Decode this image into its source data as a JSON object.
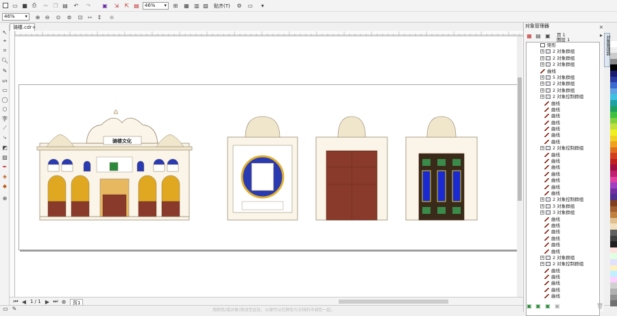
{
  "doc_tab": "骑楼.cdr",
  "toolbar": {
    "zoom": "46%",
    "snap": "贴齐(T)"
  },
  "propbar": {
    "zoom": "46%"
  },
  "building_sign": "骑楼文化",
  "pager": {
    "page": "1 / 1",
    "tab": "页1"
  },
  "status_hint": "用颜色/或对象(拖动至此处。以便可以在颜色与文档的中调色一起。",
  "panel": {
    "title": "对象管理器",
    "page": "页 1",
    "layer": "图层 1",
    "side_tab": "对象管理器",
    "rows": [
      {
        "t": "矩形",
        "k": "rect",
        "e": false,
        "i": 1
      },
      {
        "t": "2 对象群组",
        "k": "grp",
        "e": true,
        "i": 1
      },
      {
        "t": "2 对象群组",
        "k": "grp",
        "e": true,
        "i": 1
      },
      {
        "t": "2 对象群组",
        "k": "grp",
        "e": true,
        "i": 1
      },
      {
        "t": "曲线",
        "k": "curve",
        "e": false,
        "i": 1
      },
      {
        "t": "5 对象群组",
        "k": "grp",
        "e": true,
        "i": 1
      },
      {
        "t": "2 对象群组",
        "k": "grp",
        "e": true,
        "i": 1
      },
      {
        "t": "2 对象群组",
        "k": "grp",
        "e": true,
        "i": 1
      },
      {
        "t": "2 对象控制群组",
        "k": "grp",
        "e": true,
        "i": 1
      },
      {
        "t": "曲线",
        "k": "curve",
        "e": false,
        "i": 2
      },
      {
        "t": "曲线",
        "k": "curve",
        "e": false,
        "i": 2
      },
      {
        "t": "曲线",
        "k": "curve",
        "e": false,
        "i": 2
      },
      {
        "t": "曲线",
        "k": "curve",
        "e": false,
        "i": 2
      },
      {
        "t": "曲线",
        "k": "curve",
        "e": false,
        "i": 2
      },
      {
        "t": "曲线",
        "k": "curve",
        "e": false,
        "i": 2
      },
      {
        "t": "曲线",
        "k": "curve",
        "e": false,
        "i": 2
      },
      {
        "t": "2 对象控制群组",
        "k": "grp",
        "e": true,
        "i": 1
      },
      {
        "t": "曲线",
        "k": "curve",
        "e": false,
        "i": 2
      },
      {
        "t": "曲线",
        "k": "curve",
        "e": false,
        "i": 2
      },
      {
        "t": "曲线",
        "k": "curve",
        "e": false,
        "i": 2
      },
      {
        "t": "曲线",
        "k": "curve",
        "e": false,
        "i": 2
      },
      {
        "t": "曲线",
        "k": "curve",
        "e": false,
        "i": 2
      },
      {
        "t": "曲线",
        "k": "curve",
        "e": false,
        "i": 2
      },
      {
        "t": "曲线",
        "k": "curve",
        "e": false,
        "i": 2
      },
      {
        "t": "2 对象控制群组",
        "k": "grp",
        "e": true,
        "i": 1
      },
      {
        "t": "3 对象群组",
        "k": "grp",
        "e": true,
        "i": 1
      },
      {
        "t": "3 对象群组",
        "k": "grp",
        "e": true,
        "i": 1
      },
      {
        "t": "曲线",
        "k": "curve",
        "e": false,
        "i": 2
      },
      {
        "t": "曲线",
        "k": "curve",
        "e": false,
        "i": 2
      },
      {
        "t": "曲线",
        "k": "curve",
        "e": false,
        "i": 2
      },
      {
        "t": "曲线",
        "k": "curve",
        "e": false,
        "i": 2
      },
      {
        "t": "曲线",
        "k": "curve",
        "e": false,
        "i": 2
      },
      {
        "t": "曲线",
        "k": "curve",
        "e": false,
        "i": 2
      },
      {
        "t": "2 对象群组",
        "k": "grp",
        "e": true,
        "i": 1
      },
      {
        "t": "2 对象控制群组",
        "k": "grp",
        "e": true,
        "i": 1
      },
      {
        "t": "曲线",
        "k": "curve",
        "e": false,
        "i": 2
      },
      {
        "t": "曲线",
        "k": "curve",
        "e": false,
        "i": 2
      },
      {
        "t": "曲线",
        "k": "curve",
        "e": false,
        "i": 2
      },
      {
        "t": "曲线",
        "k": "curve",
        "e": false,
        "i": 2
      },
      {
        "t": "曲线",
        "k": "curve",
        "e": false,
        "i": 2
      }
    ]
  },
  "palette": [
    "#ffffff",
    "#eeeeee",
    "#cccccc",
    "#888888",
    "#000000",
    "#1a1a6e",
    "#2a3aa0",
    "#3a6ad0",
    "#60a0e0",
    "#40c0e0",
    "#20a0a0",
    "#20a060",
    "#40c040",
    "#80d040",
    "#c0e040",
    "#f0f020",
    "#f0d020",
    "#f0a020",
    "#e07020",
    "#d04020",
    "#c02020",
    "#a01040",
    "#c02070",
    "#e040a0",
    "#a040c0",
    "#7030a0",
    "#503090",
    "#804020",
    "#a06030",
    "#c08040",
    "#e0c090",
    "#f0e0c0",
    "#606060",
    "#404040",
    "#202020",
    "#ffe0e0",
    "#e0ffe0",
    "#e0e0ff",
    "#fff0c0",
    "#c0f0ff",
    "#ffd0ff",
    "#d0d0d0",
    "#b0b0b0",
    "#909090",
    "#707070"
  ]
}
